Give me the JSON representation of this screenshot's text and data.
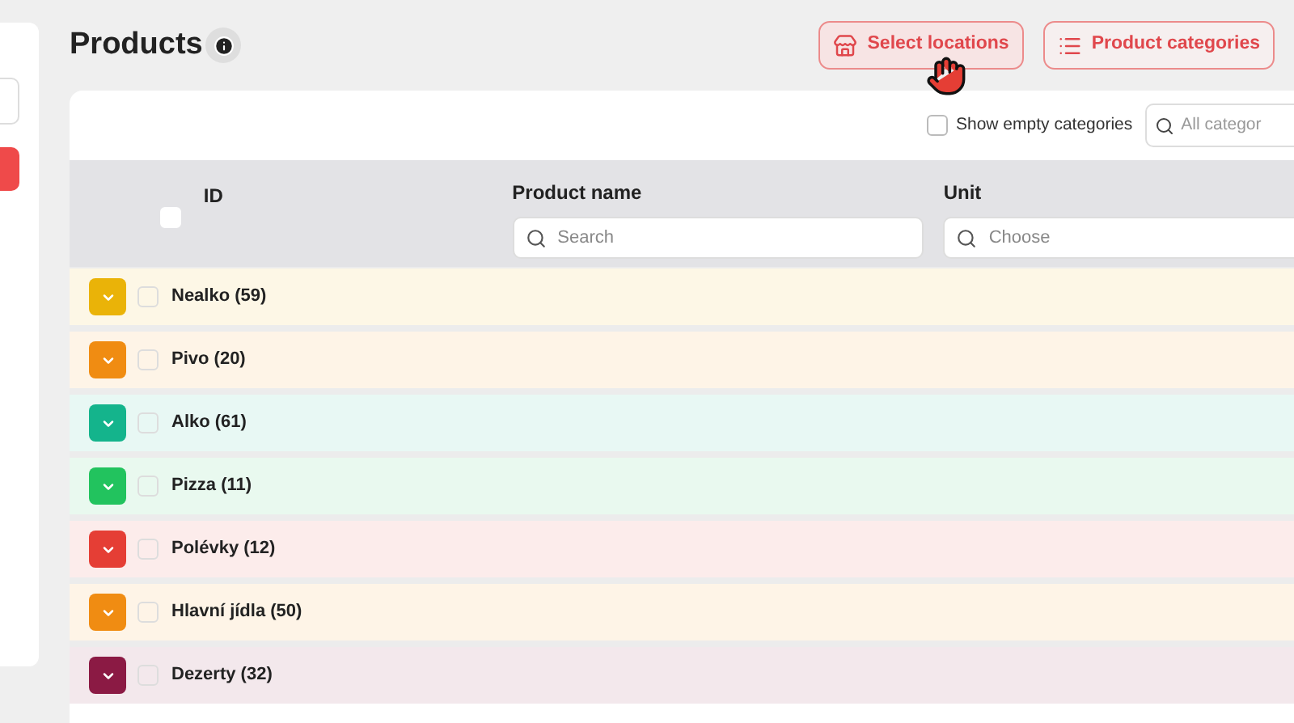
{
  "title": "Products",
  "buttons": [
    {
      "kind": "locations",
      "label": "Select locations"
    },
    {
      "kind": "categories",
      "label": "Product categories"
    }
  ],
  "show_empty": {
    "label": "Show empty categories",
    "checked": false
  },
  "category_filter": {
    "placeholder": "All categor"
  },
  "header": {
    "select_all_checked": false
  },
  "columns": [
    {
      "label": "ID"
    },
    {
      "label": "Product name",
      "placeholder": "Search"
    },
    {
      "label": "Unit",
      "placeholder": "Choose"
    }
  ],
  "rows": [
    {
      "label": "Nealko (59)",
      "color": "#eab308",
      "checked": false
    },
    {
      "label": "Pivo (20)",
      "color": "#f08c12",
      "checked": false
    },
    {
      "label": "Alko (61)",
      "color": "#14b48c",
      "checked": false
    },
    {
      "label": "Pizza (11)",
      "color": "#22c35e",
      "checked": false
    },
    {
      "label": "Polévky (12)",
      "color": "#e53e35",
      "checked": false
    },
    {
      "label": "Hlavní jídla (50)",
      "color": "#f08c12",
      "checked": false
    },
    {
      "label": "Dezerty (32)",
      "color": "#8b1a44",
      "checked": false
    }
  ]
}
